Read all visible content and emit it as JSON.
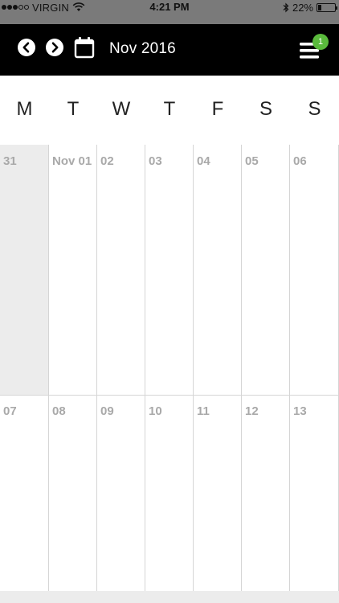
{
  "status_bar": {
    "carrier": "VIRGIN",
    "time": "4:21 PM",
    "battery": "22%",
    "battery_level": 0.22,
    "signal_bars_filled": 3,
    "signal_bars_total": 5
  },
  "toolbar": {
    "month_label": "Nov 2016",
    "menu_badge": "1",
    "icons": {
      "prev": "chevron-left-icon",
      "next": "chevron-right-icon",
      "calendar": "calendar-icon",
      "menu": "hamburger-menu-icon"
    },
    "badge_color": "#5aba3c"
  },
  "weekdays": [
    "M",
    "T",
    "W",
    "T",
    "F",
    "S",
    "S"
  ],
  "weeks": [
    [
      {
        "label": "31",
        "in_month": false
      },
      {
        "label": "Nov 01",
        "in_month": true
      },
      {
        "label": "02",
        "in_month": true
      },
      {
        "label": "03",
        "in_month": true
      },
      {
        "label": "04",
        "in_month": true
      },
      {
        "label": "05",
        "in_month": true
      },
      {
        "label": "06",
        "in_month": true
      }
    ],
    [
      {
        "label": "07",
        "in_month": true
      },
      {
        "label": "08",
        "in_month": true
      },
      {
        "label": "09",
        "in_month": true
      },
      {
        "label": "10",
        "in_month": true
      },
      {
        "label": "11",
        "in_month": true
      },
      {
        "label": "12",
        "in_month": true
      },
      {
        "label": "13",
        "in_month": true
      }
    ]
  ]
}
